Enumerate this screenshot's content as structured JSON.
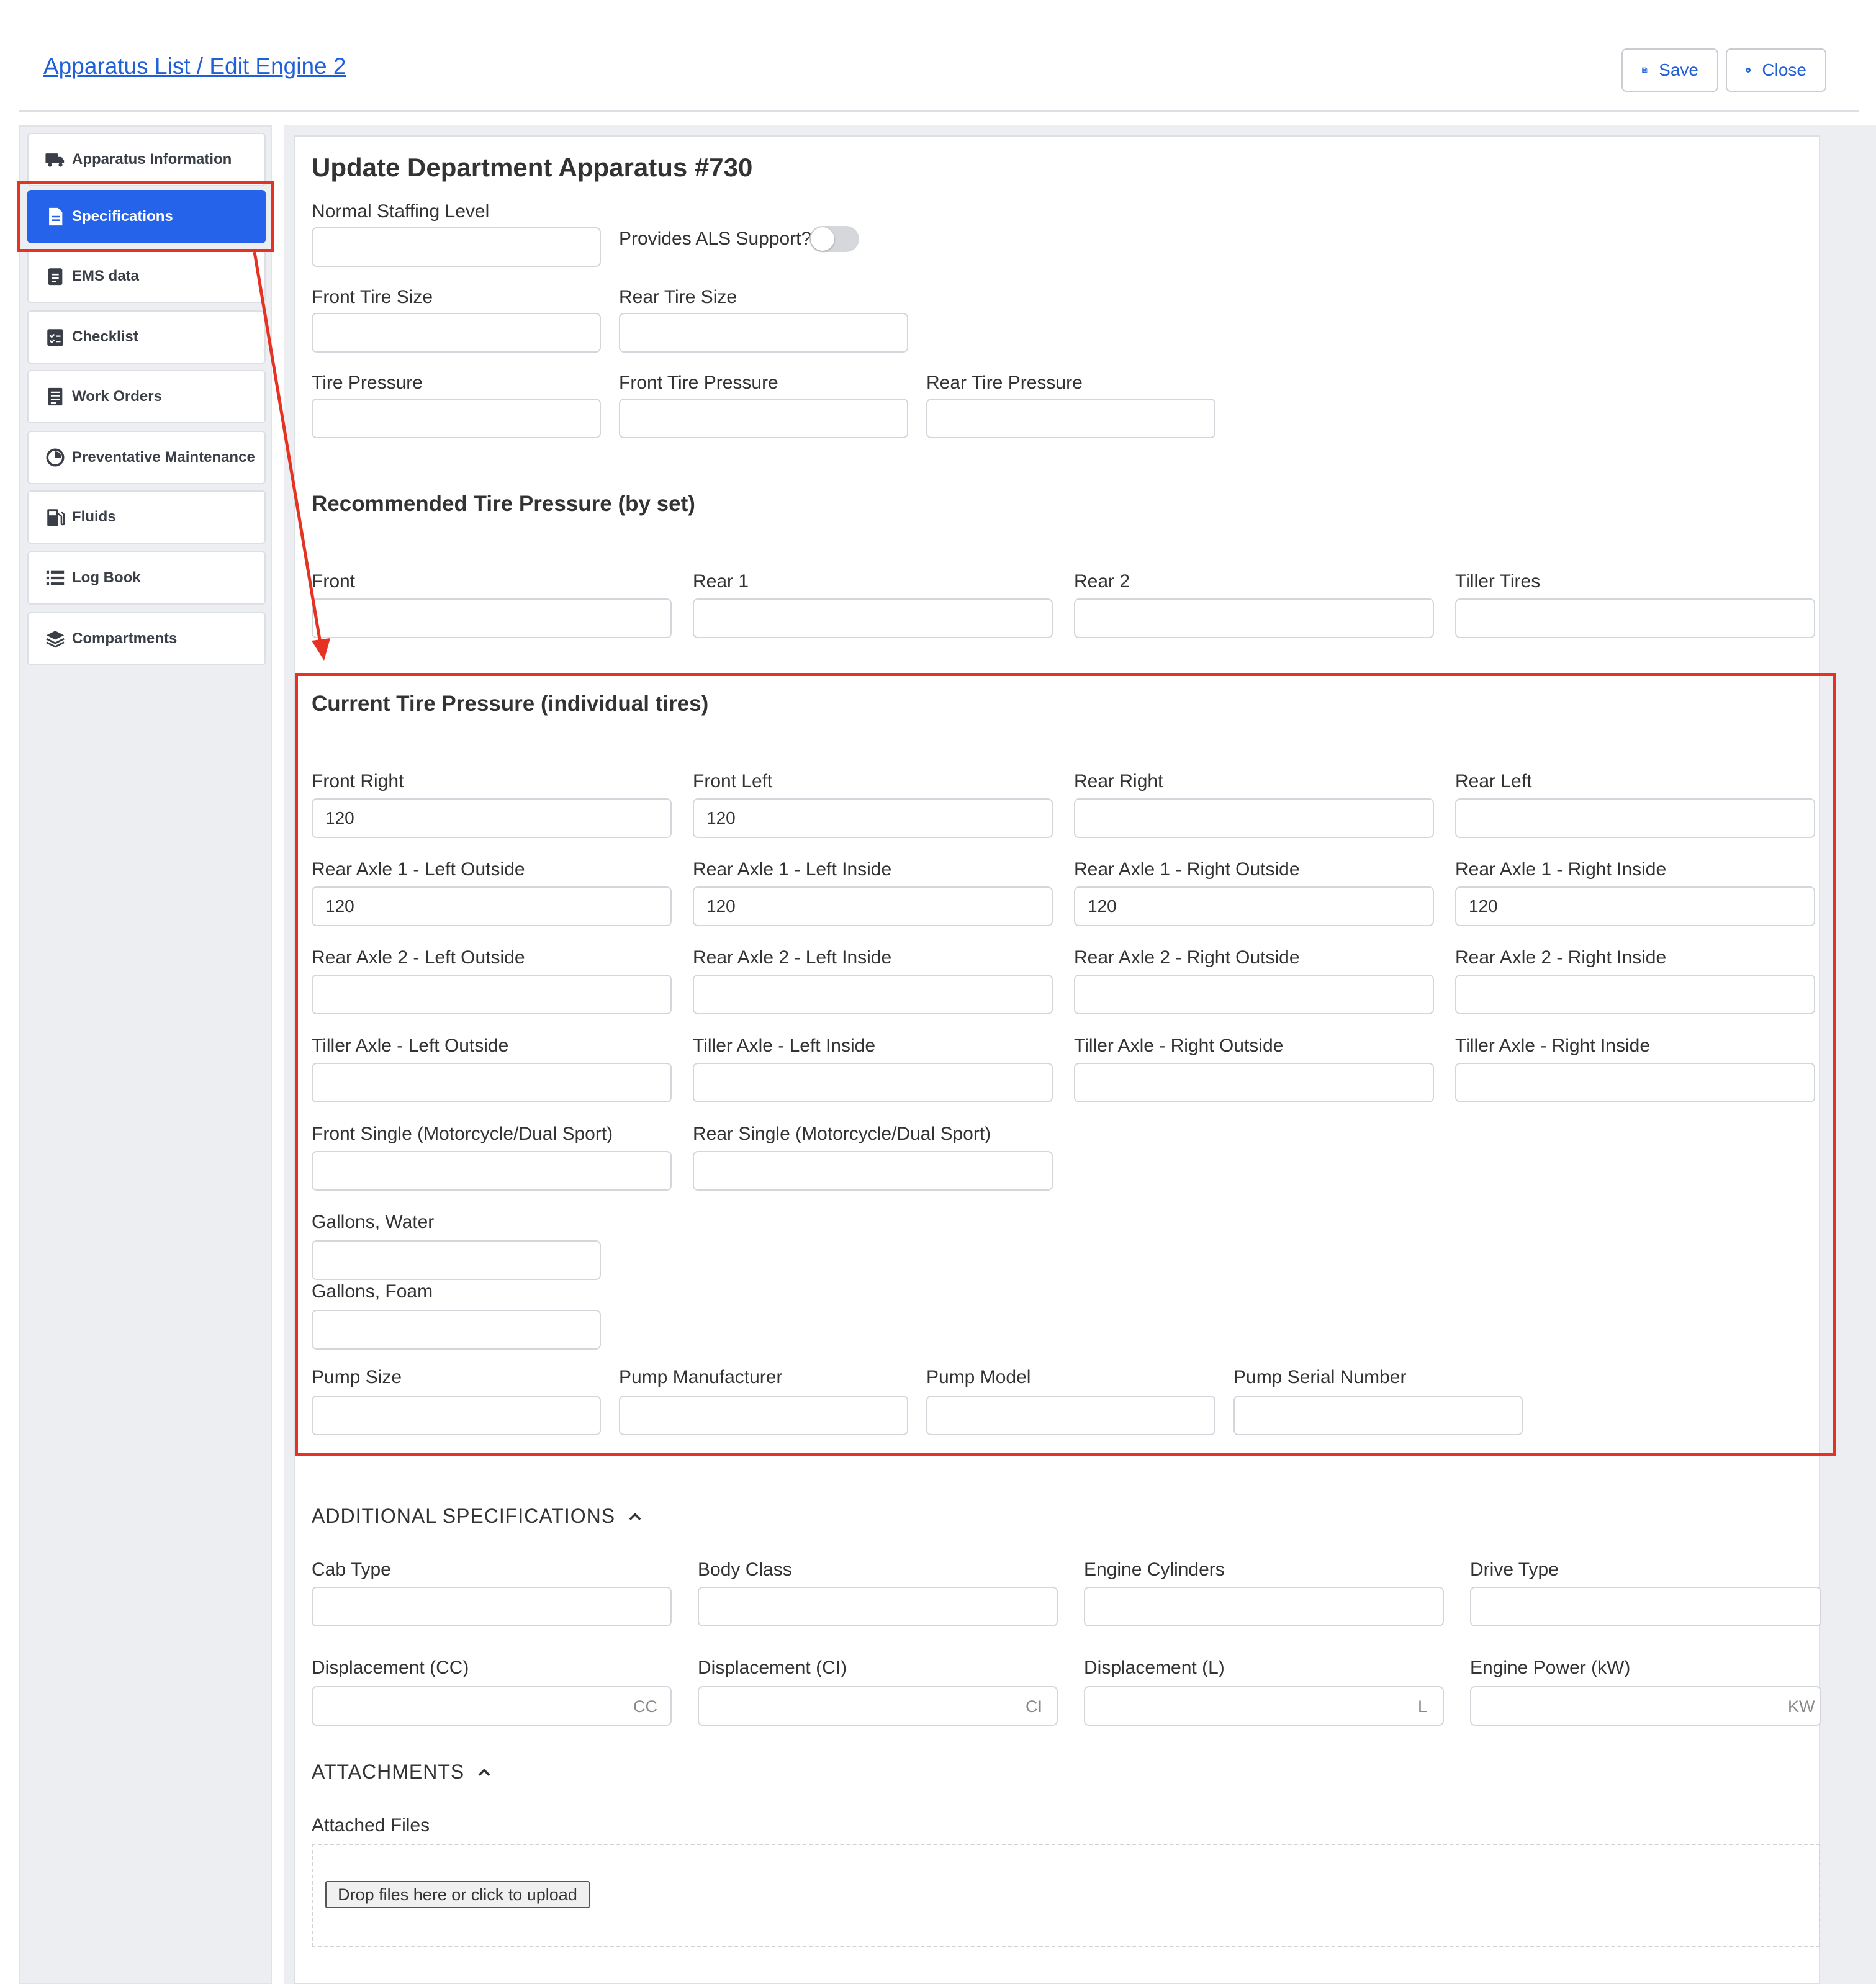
{
  "breadcrumb": "Apparatus List / Edit Engine 2",
  "toolbar": {
    "save_label": "Save",
    "close_label": "Close"
  },
  "sidebar": {
    "items": [
      {
        "label": "Apparatus Information",
        "icon": "truck-icon"
      },
      {
        "label": "Specifications",
        "icon": "document-icon",
        "active": true
      },
      {
        "label": "EMS data",
        "icon": "clipboard-icon"
      },
      {
        "label": "Checklist",
        "icon": "checklist-icon"
      },
      {
        "label": "Work Orders",
        "icon": "work-order-icon"
      },
      {
        "label": "Preventative Maintenance",
        "icon": "gauge-icon"
      },
      {
        "label": "Fluids",
        "icon": "fuel-pump-icon"
      },
      {
        "label": "Log Book",
        "icon": "list-icon"
      },
      {
        "label": "Compartments",
        "icon": "layers-icon"
      }
    ]
  },
  "form": {
    "title": "Update Department Apparatus #730",
    "normal_staffing": {
      "label": "Normal Staffing Level",
      "value": ""
    },
    "als_support": {
      "label": "Provides ALS Support?",
      "checked": false
    },
    "front_tire_size": {
      "label": "Front Tire Size",
      "value": ""
    },
    "rear_tire_size": {
      "label": "Rear Tire Size",
      "value": ""
    },
    "tire_pressure": {
      "label": "Tire Pressure",
      "value": ""
    },
    "front_tire_pressure": {
      "label": "Front Tire Pressure",
      "value": ""
    },
    "rear_tire_pressure": {
      "label": "Rear Tire Pressure",
      "value": ""
    },
    "recommended": {
      "heading": "Recommended Tire Pressure (by set)",
      "front": {
        "label": "Front",
        "value": ""
      },
      "rear1": {
        "label": "Rear 1",
        "value": ""
      },
      "rear2": {
        "label": "Rear 2",
        "value": ""
      },
      "tiller": {
        "label": "Tiller Tires",
        "value": ""
      }
    },
    "current": {
      "heading": "Current Tire Pressure (individual tires)",
      "front_right": {
        "label": "Front Right",
        "value": "120"
      },
      "front_left": {
        "label": "Front Left",
        "value": "120"
      },
      "rear_right": {
        "label": "Rear Right",
        "value": ""
      },
      "rear_left": {
        "label": "Rear Left",
        "value": ""
      },
      "ra1_lo": {
        "label": "Rear Axle 1 - Left Outside",
        "value": "120"
      },
      "ra1_li": {
        "label": "Rear Axle 1 - Left Inside",
        "value": "120"
      },
      "ra1_ro": {
        "label": "Rear Axle 1 - Right Outside",
        "value": "120"
      },
      "ra1_ri": {
        "label": "Rear Axle 1 - Right Inside",
        "value": "120"
      },
      "ra2_lo": {
        "label": "Rear Axle 2 - Left Outside",
        "value": ""
      },
      "ra2_li": {
        "label": "Rear Axle 2 - Left Inside",
        "value": ""
      },
      "ra2_ro": {
        "label": "Rear Axle 2 - Right Outside",
        "value": ""
      },
      "ra2_ri": {
        "label": "Rear Axle 2 - Right Inside",
        "value": ""
      },
      "ta_lo": {
        "label": "Tiller Axle - Left Outside",
        "value": ""
      },
      "ta_li": {
        "label": "Tiller Axle - Left Inside",
        "value": ""
      },
      "ta_ro": {
        "label": "Tiller Axle - Right Outside",
        "value": ""
      },
      "ta_ri": {
        "label": "Tiller Axle - Right Inside",
        "value": ""
      },
      "front_single": {
        "label": "Front Single (Motorcycle/Dual Sport)",
        "value": ""
      },
      "rear_single": {
        "label": "Rear Single (Motorcycle/Dual Sport)",
        "value": ""
      }
    },
    "gallons_water": {
      "label": "Gallons, Water",
      "value": ""
    },
    "gallons_foam": {
      "label": "Gallons, Foam",
      "value": ""
    },
    "pump_size": {
      "label": "Pump Size",
      "value": ""
    },
    "pump_manufacturer": {
      "label": "Pump Manufacturer",
      "value": ""
    },
    "pump_model": {
      "label": "Pump Model",
      "value": ""
    },
    "pump_serial": {
      "label": "Pump Serial Number",
      "value": ""
    }
  },
  "additional": {
    "heading": "ADDITIONAL SPECIFICATIONS",
    "cab_type": {
      "label": "Cab Type",
      "value": ""
    },
    "body_class": {
      "label": "Body Class",
      "value": ""
    },
    "engine_cylinders": {
      "label": "Engine Cylinders",
      "value": ""
    },
    "drive_type": {
      "label": "Drive Type",
      "value": ""
    },
    "disp_cc": {
      "label": "Displacement (CC)",
      "value": "",
      "suffix": "CC"
    },
    "disp_ci": {
      "label": "Displacement (CI)",
      "value": "",
      "suffix": "CI"
    },
    "disp_l": {
      "label": "Displacement (L)",
      "value": "",
      "suffix": "L"
    },
    "engine_power": {
      "label": "Engine Power (kW)",
      "value": "",
      "suffix": "KW"
    }
  },
  "attachments": {
    "heading": "ATTACHMENTS",
    "label": "Attached Files",
    "upload_label": "Drop files here or click to upload"
  },
  "colors": {
    "accent": "#2563eb",
    "link": "#1f5fd8",
    "annotation": "#e53222"
  }
}
